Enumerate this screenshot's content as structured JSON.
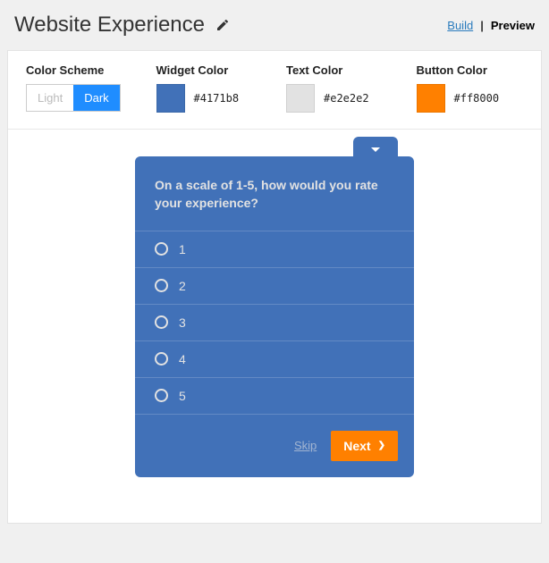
{
  "header": {
    "title": "Website Experience",
    "tabs": {
      "build": "Build",
      "preview": "Preview",
      "active": "preview"
    }
  },
  "config": {
    "color_scheme": {
      "label": "Color Scheme",
      "options": {
        "light": "Light",
        "dark": "Dark"
      },
      "value": "dark"
    },
    "widget_color": {
      "label": "Widget Color",
      "value": "#4171b8"
    },
    "text_color": {
      "label": "Text Color",
      "value": "#e2e2e2"
    },
    "button_color": {
      "label": "Button Color",
      "value": "#ff8000"
    }
  },
  "widget": {
    "question": "On a scale of 1-5, how would you rate your experience?",
    "options": [
      "1",
      "2",
      "3",
      "4",
      "5"
    ],
    "skip_label": "Skip",
    "next_label": "Next"
  }
}
